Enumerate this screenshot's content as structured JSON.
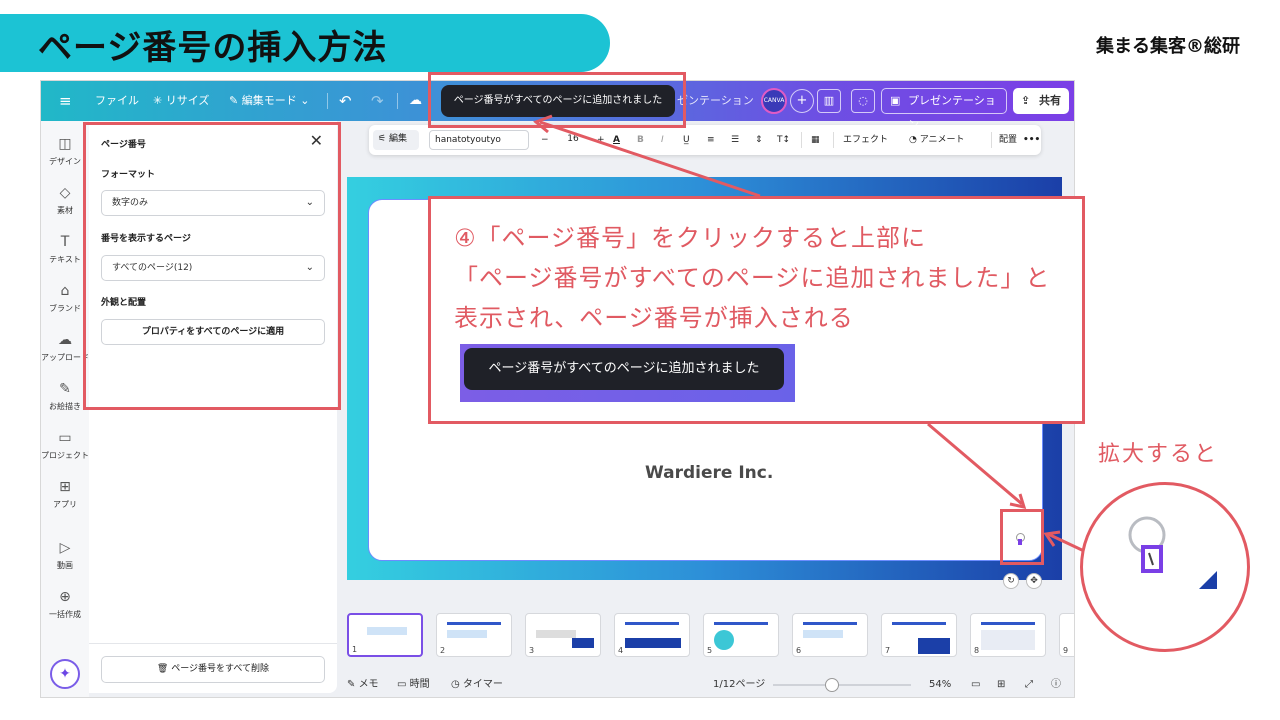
{
  "header": {
    "title": "ページ番号の挿入方法",
    "brand": "集まる集客®総研"
  },
  "topbar": {
    "menu_icon": "hamburger-icon",
    "file": "ファイル",
    "resize": "リサイズ",
    "edit_mode": "編集モード",
    "presentation_partial": "ゼンテーション",
    "present_button": "プレゼンテーション",
    "share_button": "共有",
    "avatar_text": "CANVA"
  },
  "toast": {
    "message": "ページ番号がすべてのページに追加されました"
  },
  "rail": {
    "items": [
      {
        "label": "デザイン",
        "icon": "layout-icon"
      },
      {
        "label": "素材",
        "icon": "elements-icon"
      },
      {
        "label": "テキスト",
        "icon": "text-icon"
      },
      {
        "label": "ブランド",
        "icon": "brand-icon"
      },
      {
        "label": "アップロード",
        "icon": "upload-icon"
      },
      {
        "label": "お絵描き",
        "icon": "draw-icon"
      },
      {
        "label": "プロジェクト",
        "icon": "folder-icon"
      },
      {
        "label": "アプリ",
        "icon": "apps-icon"
      },
      {
        "label": "動画",
        "icon": "video-icon"
      },
      {
        "label": "一括作成",
        "icon": "bulk-icon"
      }
    ]
  },
  "panel": {
    "title": "ページ番号",
    "format_label": "フォーマット",
    "format_value": "数字のみ",
    "pages_label": "番号を表示するページ",
    "pages_value": "すべてのページ(12)",
    "appearance_label": "外観と配置",
    "apply_button": "プロパティをすべてのページに適用",
    "delete_button": "ページ番号をすべて削除"
  },
  "text_toolbar": {
    "edit": "編集",
    "font": "hanatotyoutyo",
    "minus": "−",
    "size": "16",
    "plus": "+",
    "color": "A",
    "bold": "B",
    "italic": "I",
    "effects": "エフェクト",
    "animate": "アニメート",
    "position": "配置",
    "more": "•••"
  },
  "slide": {
    "company": "Wardiere Inc."
  },
  "thumbnails": [
    "1",
    "2",
    "3",
    "4",
    "5",
    "6",
    "7",
    "8",
    "9"
  ],
  "bottombar": {
    "notes": "メモ",
    "timer_label": "時間",
    "timer": "タイマー",
    "page_indicator": "1/12ページ",
    "zoom": "54%",
    "zoom_fraction": 0.54
  },
  "annotation": {
    "line1": "④「ページ番号」をクリックすると上部に",
    "line2": "「ページ番号がすべてのページに追加されました」と",
    "line3": "表示され、ページ番号が挿入される",
    "zoom_label": "拡大すると"
  },
  "colors": {
    "accent_red": "#e25a62",
    "title_bar": "#1cc3d4",
    "canva_purple": "#7b3fe6"
  }
}
